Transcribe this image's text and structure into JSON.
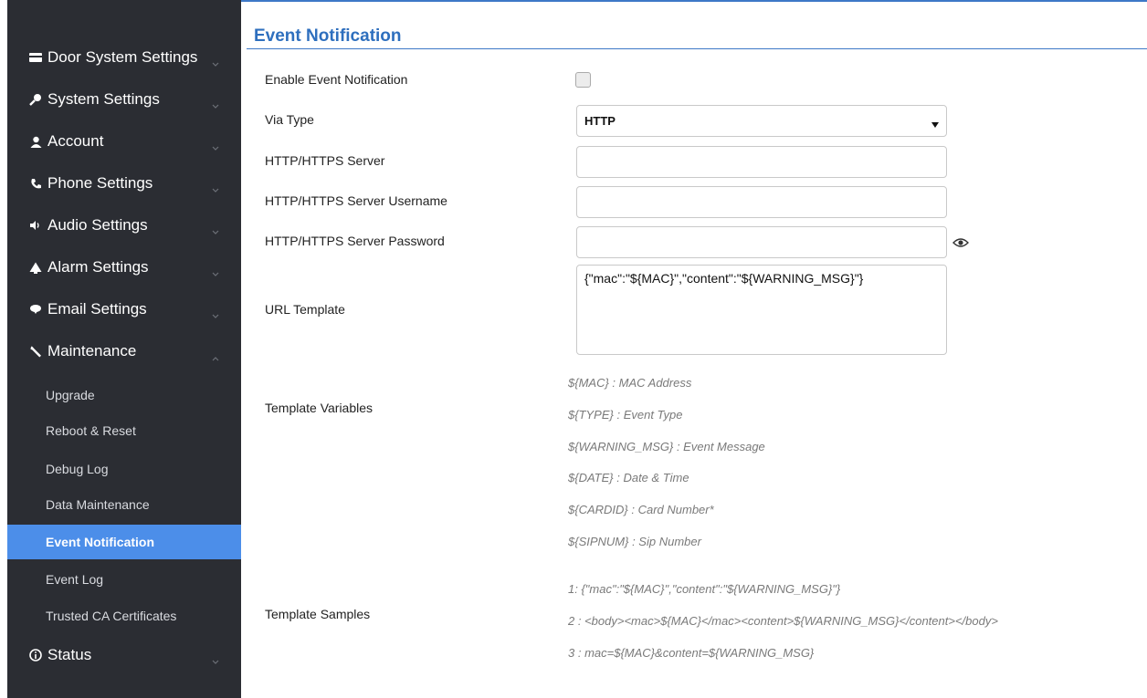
{
  "sidebar": {
    "menu": [
      {
        "label": "Door System Settings",
        "icon": "card-icon"
      },
      {
        "label": "System Settings",
        "icon": "key-icon"
      },
      {
        "label": "Account",
        "icon": "user-icon"
      },
      {
        "label": "Phone Settings",
        "icon": "phone-icon"
      },
      {
        "label": "Audio Settings",
        "icon": "speaker-icon"
      },
      {
        "label": "Alarm Settings",
        "icon": "alarm-icon"
      },
      {
        "label": "Email Settings",
        "icon": "cloud-icon"
      },
      {
        "label": "Maintenance",
        "icon": "wrench-icon"
      },
      {
        "label": "Status",
        "icon": "info-icon"
      }
    ],
    "maintenance_items": [
      {
        "label": "Upgrade"
      },
      {
        "label": "Reboot & Reset"
      },
      {
        "label": "Debug Log"
      },
      {
        "label": "Data Maintenance"
      },
      {
        "label": "Event Notification"
      },
      {
        "label": "Event Log"
      },
      {
        "label": "Trusted CA Certificates"
      }
    ],
    "active_item": "Event Notification"
  },
  "page": {
    "title": "Event Notification"
  },
  "form": {
    "enable_label": "Enable Event Notification",
    "enable_checked": false,
    "via_type_label": "Via Type",
    "via_type_value": "HTTP",
    "server_label": "HTTP/HTTPS Server",
    "server_value": "",
    "username_label": "HTTP/HTTPS Server Username",
    "username_value": "",
    "password_label": "HTTP/HTTPS Server Password",
    "password_value": "",
    "url_template_label": "URL Template",
    "url_template_value": "{\"mac\":\"${MAC}\",\"content\":\"${WARNING_MSG}\"}",
    "template_variables_label": "Template Variables",
    "template_variables": [
      "${MAC} : MAC Address",
      "${TYPE} : Event Type",
      "${WARNING_MSG} : Event Message",
      "${DATE} : Date & Time",
      "${CARDID} : Card Number*",
      "${SIPNUM} : Sip Number"
    ],
    "template_samples_label": "Template Samples",
    "template_samples": [
      "1: {\"mac\":\"${MAC}\",\"content\":\"${WARNING_MSG}\"}",
      "2 : <body><mac>${MAC}</mac><content>${WARNING_MSG}</content></body>",
      "3 : mac=${MAC}&content=${WARNING_MSG}"
    ]
  },
  "colors": {
    "sidebar_bg": "#2b2d33",
    "active_bg": "#4c8ee9",
    "accent": "#2e6fbe"
  }
}
